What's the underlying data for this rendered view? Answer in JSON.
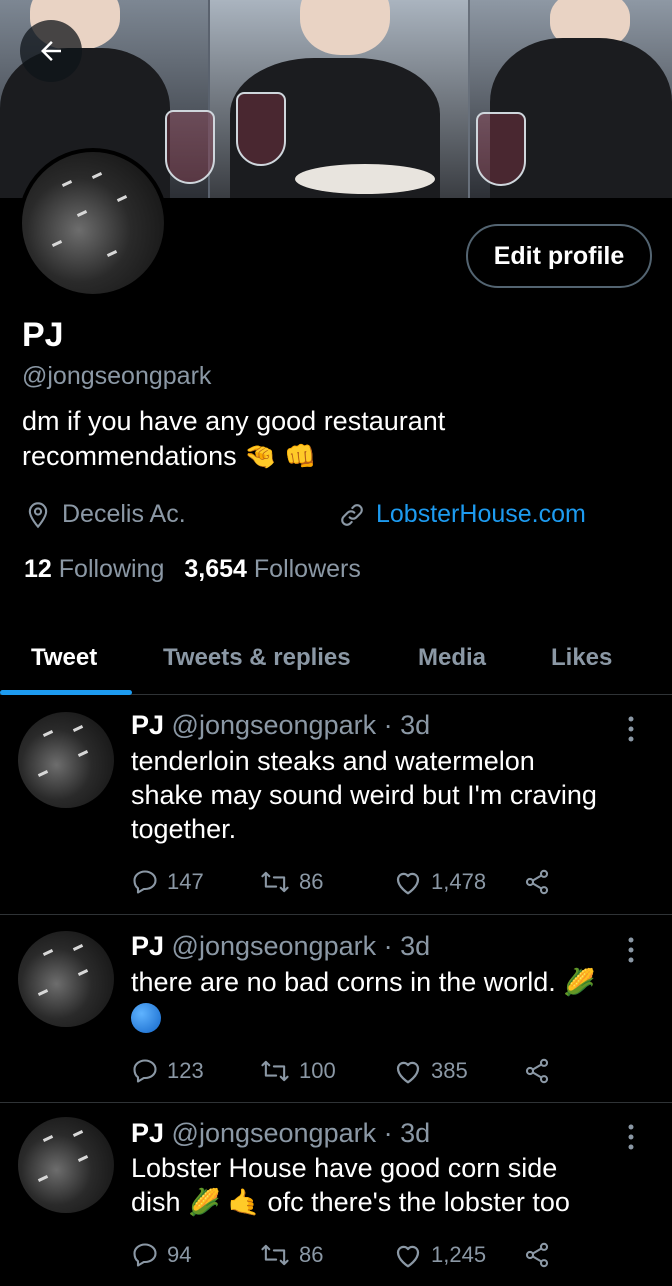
{
  "profile": {
    "name": "PJ",
    "handle": "@jongseongpark",
    "bio_line1": "dm if you have any good restaurant",
    "bio_line2": "recommendations",
    "bio_emojis": [
      "🤏",
      "👊"
    ],
    "location": "Decelis Ac.",
    "website": "LobsterHouse.com",
    "following_count": "12",
    "following_label": "Following",
    "followers_count": "3,654",
    "followers_label": "Followers",
    "edit_button": "Edit profile"
  },
  "tabs": [
    {
      "label": "Tweet",
      "active": true
    },
    {
      "label": "Tweets & replies",
      "active": false
    },
    {
      "label": "Media",
      "active": false
    },
    {
      "label": "Likes",
      "active": false
    }
  ],
  "tweets": [
    {
      "name": "PJ",
      "handle": "@jongseongpark · 3d",
      "text_lines": [
        "tenderloin steaks and watermelon",
        "shake may sound weird but I'm craving",
        "together."
      ],
      "replies": "147",
      "retweets": "86",
      "likes": "1,478"
    },
    {
      "name": "PJ",
      "handle": "@jongseongpark · 3d",
      "text_lines": [
        "there are no bad corns in the world."
      ],
      "emoji_inline": "🌽",
      "replies": "123",
      "retweets": "100",
      "likes": "385"
    },
    {
      "name": "PJ",
      "handle": "@jongseongpark · 3d",
      "text_line1": "Lobster House have good corn side",
      "text_line2_prefix": "dish",
      "text_line2_emojis": "🌽 🤙",
      "text_line2_suffix": "ofc there's the lobster too",
      "replies": "94",
      "retweets": "86",
      "likes": "1,245"
    }
  ],
  "colors": {
    "background": "#000000",
    "accent": "#1d9bf0",
    "secondary_text": "#8b98a5",
    "divider": "#2f3336"
  },
  "icons": [
    "back-arrow-icon",
    "location-pin-icon",
    "link-icon",
    "reply-icon",
    "retweet-icon",
    "like-icon",
    "share-icon",
    "more-vertical-icon"
  ]
}
